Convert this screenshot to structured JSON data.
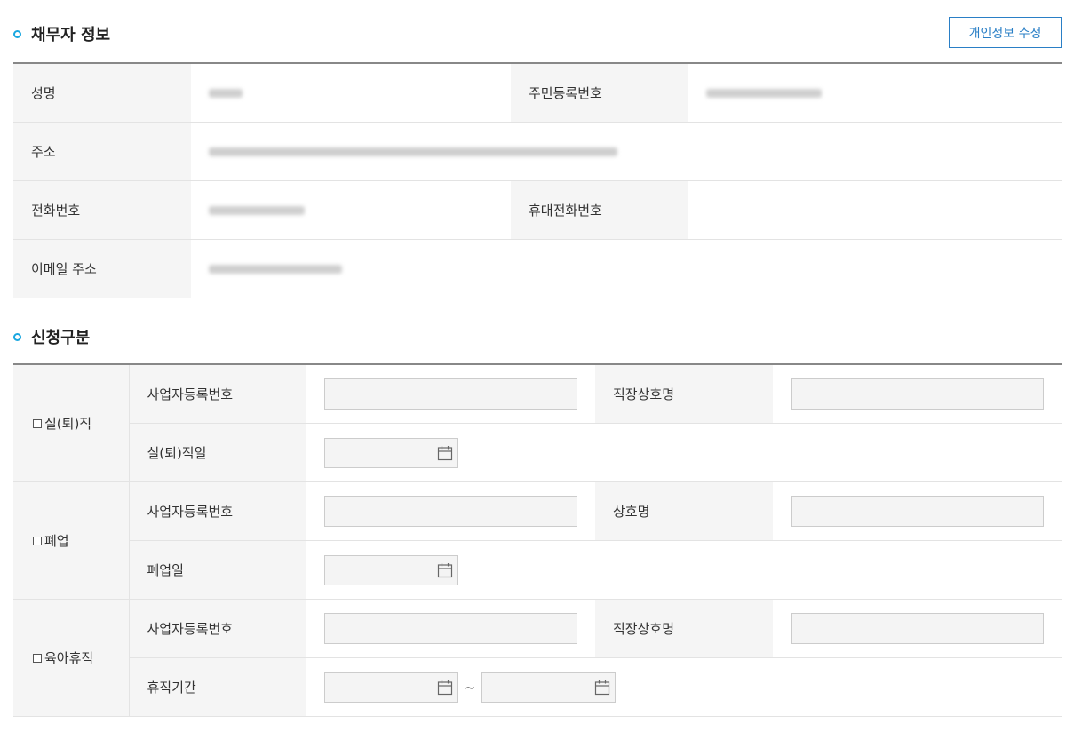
{
  "debtor": {
    "title": "채무자 정보",
    "edit_button": "개인정보 수정",
    "labels": {
      "name": "성명",
      "rrn": "주민등록번호",
      "address": "주소",
      "phone": "전화번호",
      "mobile": "휴대전화번호",
      "email": "이메일 주소"
    }
  },
  "apply": {
    "title": "신청구분",
    "groups": [
      {
        "category": "실(퇴)직",
        "row1": {
          "label_a": "사업자등록번호",
          "label_b": "직장상호명"
        },
        "row2": {
          "label": "실(퇴)직일"
        }
      },
      {
        "category": "폐업",
        "row1": {
          "label_a": "사업자등록번호",
          "label_b": "상호명"
        },
        "row2": {
          "label": "폐업일"
        }
      },
      {
        "category": "육아휴직",
        "row1": {
          "label_a": "사업자등록번호",
          "label_b": "직장상호명"
        },
        "row2": {
          "label": "휴직기간",
          "separator": "~"
        }
      }
    ]
  },
  "icons": {
    "calendar": "calendar-icon",
    "checkbox": "checkbox-icon",
    "bullet": "bullet-icon"
  },
  "colors": {
    "accent": "#1aa7e0",
    "button_border": "#2a7fc6"
  }
}
